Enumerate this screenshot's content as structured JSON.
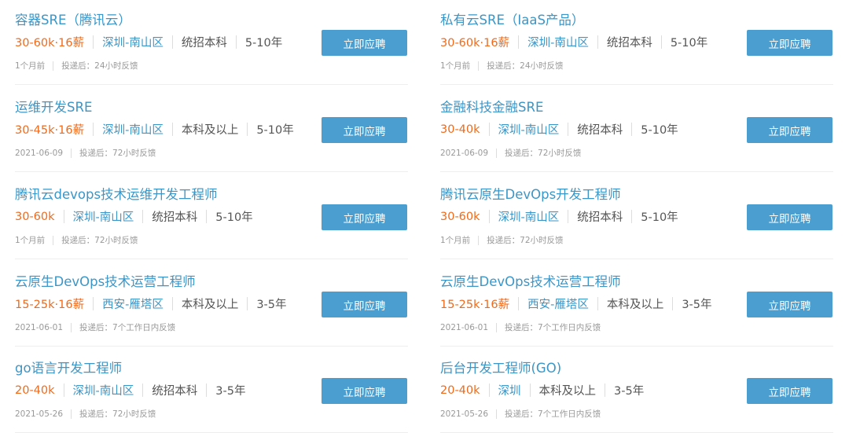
{
  "jobs": [
    {
      "title": "容器SRE（腾讯云）",
      "salary": "30-60k·16薪",
      "location": "深圳-南山区",
      "education": "统招本科",
      "experience": "5-10年",
      "posted": "1个月前",
      "feedback": "投递后：24小时反馈",
      "apply_label": "立即应聘"
    },
    {
      "title": "私有云SRE（IaaS产品）",
      "salary": "30-60k·16薪",
      "location": "深圳-南山区",
      "education": "统招本科",
      "experience": "5-10年",
      "posted": "1个月前",
      "feedback": "投递后：24小时反馈",
      "apply_label": "立即应聘"
    },
    {
      "title": "运维开发SRE",
      "salary": "30-45k·16薪",
      "location": "深圳-南山区",
      "education": "本科及以上",
      "experience": "5-10年",
      "posted": "2021-06-09",
      "feedback": "投递后：72小时反馈",
      "apply_label": "立即应聘"
    },
    {
      "title": "金融科技金融SRE",
      "salary": "30-40k",
      "location": "深圳-南山区",
      "education": "统招本科",
      "experience": "5-10年",
      "posted": "2021-06-09",
      "feedback": "投递后：72小时反馈",
      "apply_label": "立即应聘"
    },
    {
      "title": "腾讯云devops技术运维开发工程师",
      "salary": "30-60k",
      "location": "深圳-南山区",
      "education": "统招本科",
      "experience": "5-10年",
      "posted": "1个月前",
      "feedback": "投递后：72小时反馈",
      "apply_label": "立即应聘"
    },
    {
      "title": "腾讯云原生DevOps开发工程师",
      "salary": "30-60k",
      "location": "深圳-南山区",
      "education": "统招本科",
      "experience": "5-10年",
      "posted": "1个月前",
      "feedback": "投递后：72小时反馈",
      "apply_label": "立即应聘"
    },
    {
      "title": "云原生DevOps技术运营工程师",
      "salary": "15-25k·16薪",
      "location": "西安-雁塔区",
      "education": "本科及以上",
      "experience": "3-5年",
      "posted": "2021-06-01",
      "feedback": "投递后：7个工作日内反馈",
      "apply_label": "立即应聘"
    },
    {
      "title": "云原生DevOps技术运营工程师",
      "salary": "15-25k·16薪",
      "location": "西安-雁塔区",
      "education": "本科及以上",
      "experience": "3-5年",
      "posted": "2021-06-01",
      "feedback": "投递后：7个工作日内反馈",
      "apply_label": "立即应聘"
    },
    {
      "title": "go语言开发工程师",
      "salary": "20-40k",
      "location": "深圳-南山区",
      "education": "统招本科",
      "experience": "3-5年",
      "posted": "2021-05-26",
      "feedback": "投递后：72小时反馈",
      "apply_label": "立即应聘"
    },
    {
      "title": "后台开发工程师(GO)",
      "salary": "20-40k",
      "location": "深圳",
      "education": "本科及以上",
      "experience": "3-5年",
      "posted": "2021-05-26",
      "feedback": "投递后：7个工作日内反馈",
      "apply_label": "立即应聘"
    }
  ],
  "colors": {
    "title": "#3a96c8",
    "salary": "#f06a1b",
    "button": "#4a9fd0",
    "muted": "#999999"
  }
}
